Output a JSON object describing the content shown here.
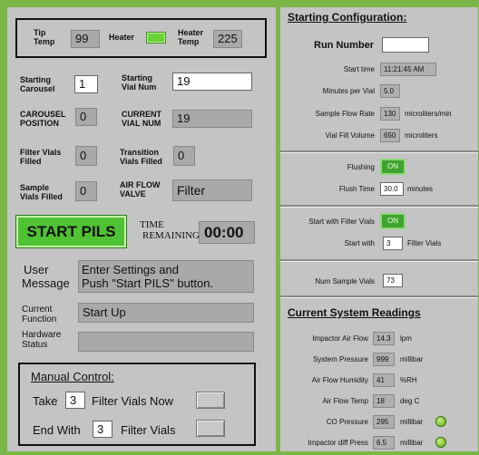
{
  "left": {
    "tip_temp_label": [
      "Tip",
      "Temp"
    ],
    "tip_temp_value": "99",
    "heater_label": "Heater",
    "heater_temp_label": [
      "Heater",
      "Temp"
    ],
    "heater_temp_value": "225",
    "starting_carousel_label": [
      "Starting",
      "Carousel"
    ],
    "starting_carousel_value": "1",
    "starting_vial_num_label": [
      "Starting",
      "Vial Num"
    ],
    "starting_vial_num_value": "19",
    "carousel_position_label": [
      "CAROUSEL",
      "POSITION"
    ],
    "carousel_position_value": "0",
    "current_vial_num_label": [
      "CURRENT",
      "VIAL NUM"
    ],
    "current_vial_num_value": "19",
    "filter_vials_filled_label": [
      "Filter Vials",
      "Filled"
    ],
    "filter_vials_filled_value": "0",
    "transition_vials_filled_label": [
      "Transition",
      "Vials Filled"
    ],
    "transition_vials_filled_value": "0",
    "sample_vials_filled_label": [
      "Sample",
      "Vials Filled"
    ],
    "sample_vials_filled_value": "0",
    "air_flow_valve_label": [
      "AIR FLOW",
      "VALVE"
    ],
    "air_flow_valve_value": "Filter",
    "start_button_label": "START PILS",
    "time_remaining_label": [
      "TIME",
      "REMAINING"
    ],
    "time_remaining_value": "00:00",
    "user_message_label": [
      "User",
      "Message"
    ],
    "user_message_value": [
      "Enter Settings and",
      "Push \"Start PILS\" button."
    ],
    "current_function_label": [
      "Current",
      "Function"
    ],
    "current_function_value": "Start Up",
    "hardware_status_label": [
      "Hardware",
      "Status"
    ],
    "hardware_status_value": "",
    "manual_control_title": "Manual Control:",
    "take_label": "Take",
    "take_value": "3",
    "take_suffix": "Filter Vials Now",
    "end_with_label": "End With",
    "end_with_value": "3",
    "end_with_suffix": "Filter Vials"
  },
  "right": {
    "starting_config_title": "Starting Configuration:",
    "run_number_label": "Run Number",
    "run_number_value": "",
    "start_time_label": "Start time",
    "start_time_value": "11:21:45 AM",
    "minutes_per_vial_label": "Minutes per Vial",
    "minutes_per_vial_value": "5.0",
    "sample_flow_rate_label": "Sample Flow Rate",
    "sample_flow_rate_value": "130",
    "sample_flow_rate_unit": "microliters/min",
    "vial_fill_volume_label": "Vial Fill Volume",
    "vial_fill_volume_value": "650",
    "vial_fill_volume_unit": "microliters",
    "flushing_label": "Flushing",
    "flushing_value": "ON",
    "flush_time_label": "Flush Time",
    "flush_time_value": "30.0",
    "flush_time_unit": "minutes",
    "start_with_filter_vials_label": "Start with Filter Vials",
    "start_with_filter_vials_value": "ON",
    "start_with_label": "Start with",
    "start_with_value": "3",
    "start_with_unit": "Filter Vials",
    "num_sample_vials_label": "Num Sample Vials",
    "num_sample_vials_value": "73",
    "current_readings_title": "Current System Readings",
    "readings": [
      {
        "label": "Impactor Air Flow",
        "value": "14.3",
        "unit": "lpm",
        "led": false
      },
      {
        "label": "System Pressure",
        "value": "999",
        "unit": "millibar",
        "led": false
      },
      {
        "label": "Air Flow Humidity",
        "value": "41",
        "unit": "%RH",
        "led": false
      },
      {
        "label": "Air Flow Temp",
        "value": "18",
        "unit": "deg C",
        "led": false
      },
      {
        "label": "CO Pressure",
        "value": "295",
        "unit": "millibar",
        "led": true
      },
      {
        "label": "Impactor diff Press",
        "value": "6.5",
        "unit": "millibar",
        "led": true
      }
    ]
  },
  "colors": {
    "background": "#7ab648",
    "panel": "#c4c4c4",
    "start_button": "#4fc234",
    "led_on": "#3fa32f"
  }
}
